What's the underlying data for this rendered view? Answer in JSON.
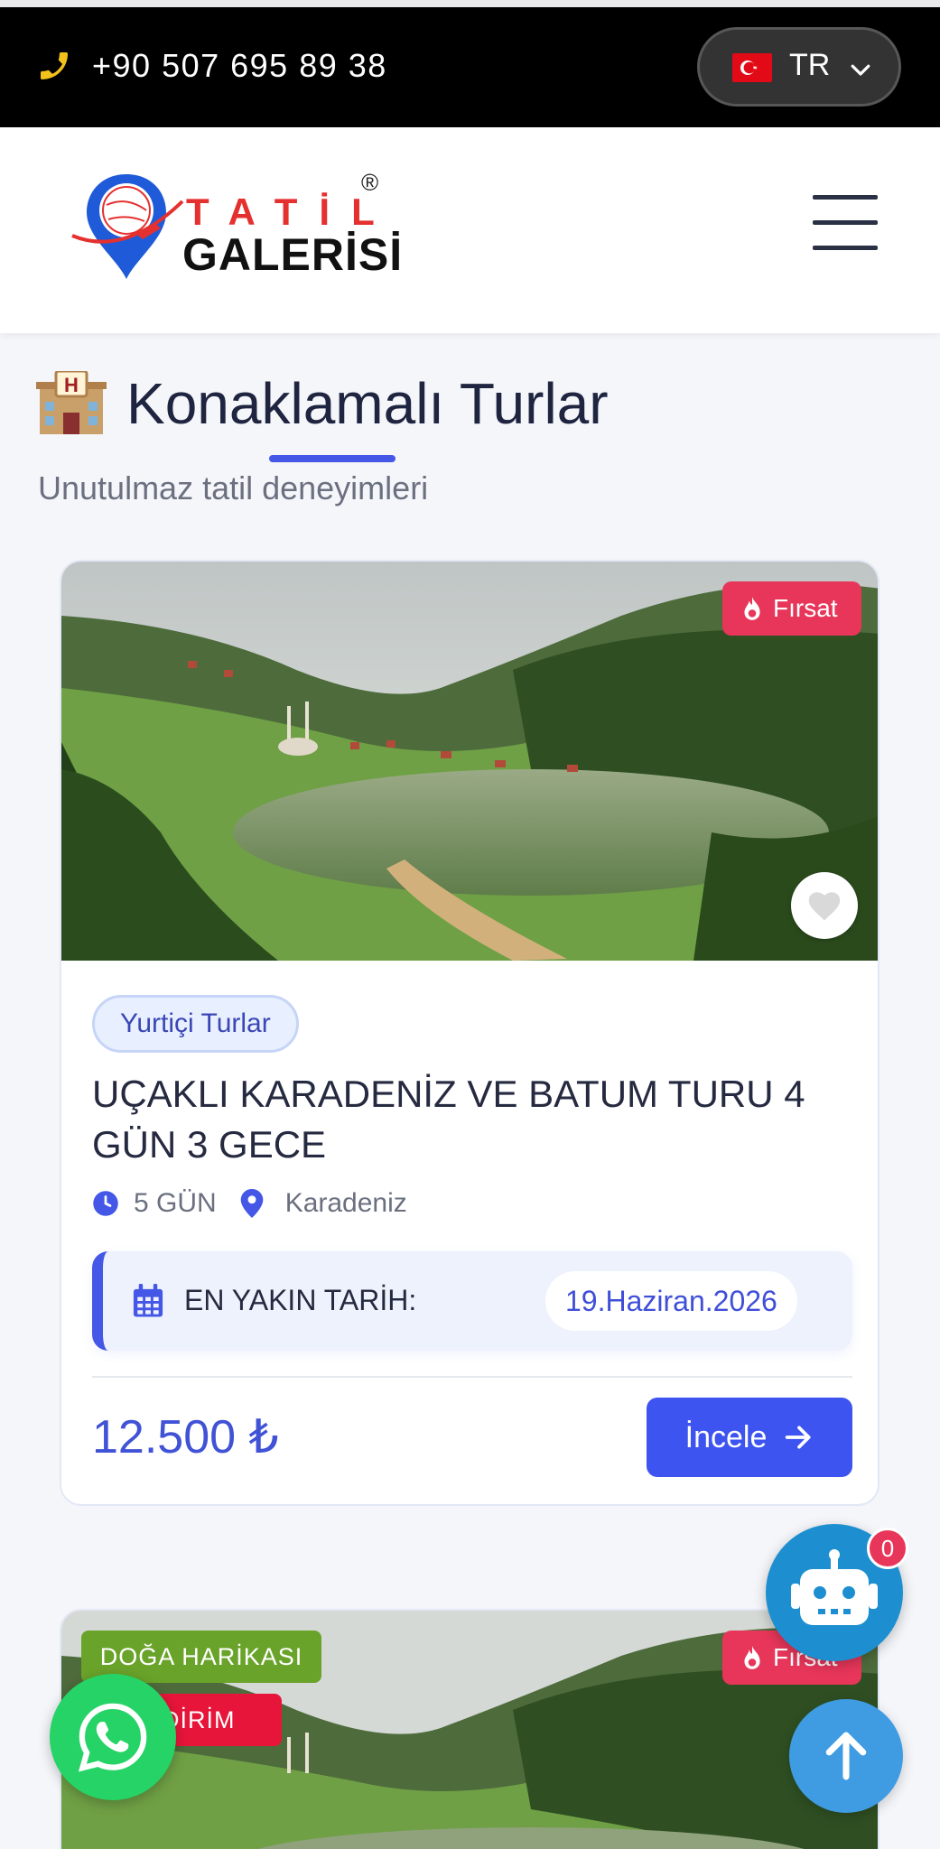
{
  "topbar": {
    "phone": "+90 507 695 89 38",
    "phone_icon": "phone-icon",
    "language": "TR",
    "flag_icon": "turkey-flag-icon"
  },
  "header": {
    "logo_top": "TATİL",
    "logo_bottom": "GALERİSİ",
    "logo_mark": "®",
    "menu_icon": "hamburger-menu-icon"
  },
  "section": {
    "emoji": "hotel-icon",
    "title": "Konaklamalı Turlar",
    "subtitle": "Unutulmaz tatil deneyimleri"
  },
  "tours": [
    {
      "badge": "Fırsat",
      "category": "Yurtiçi Turlar",
      "title": "UÇAKLI KARADENİZ VE BATUM TURU 4 GÜN 3 GECE",
      "duration": "5 GÜN",
      "location": "Karadeniz",
      "date_label": "EN YAKIN TARİH:",
      "date_value": "19.Haziran.2026",
      "price": "12.500 ₺",
      "cta": "İncele"
    },
    {
      "badge": "Fırsat",
      "tag_green": "DOĞA HARİKASI",
      "tag_red": "İNDİRİM"
    }
  ],
  "floating": {
    "chatbot_count": "0",
    "chatbot_icon": "robot-icon",
    "whatsapp_icon": "whatsapp-icon",
    "scroll_top_icon": "arrow-up-icon"
  },
  "colors": {
    "accent": "#4457e6",
    "button": "#3d54f0",
    "badge_red": "#e8365a",
    "badge_green": "#6aa32a"
  }
}
